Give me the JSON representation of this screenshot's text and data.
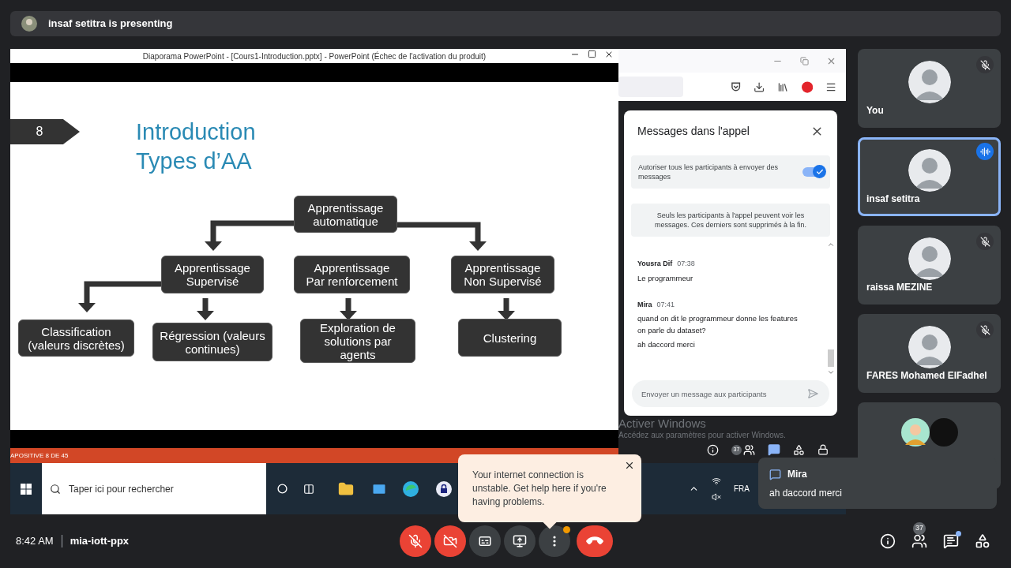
{
  "presenter_banner": {
    "text": "insaf setitra is presenting"
  },
  "shared_screen": {
    "powerpoint": {
      "title": "Diaporama PowerPoint - [Cours1-Introduction.pptx] - PowerPoint (Échec de l'activation du produit)",
      "slide_number": "8",
      "slide_title": [
        "Introduction",
        "Types d’AA"
      ],
      "nodes": [
        {
          "label": "Apprentissage\nautomatique"
        },
        {
          "label": "Apprentissage\nSupervisé"
        },
        {
          "label": "Apprentissage\nPar renforcement"
        },
        {
          "label": "Apprentissage\nNon Supervisé"
        },
        {
          "label": "Classification\n(valeurs discrètes)"
        },
        {
          "label": "Régression (valeurs\ncontinues)"
        },
        {
          "label": "Exploration de\nsolutions par\nagents"
        },
        {
          "label": "Clustering"
        }
      ],
      "status": "APOSITIVE 8 DE 45"
    },
    "chat": {
      "title": "Messages dans l'appel",
      "setting": {
        "label": "Autoriser tous les participants à envoyer des messages",
        "on": true
      },
      "notice": "Seuls les participants à l'appel peuvent voir les messages. Ces derniers sont supprimés à la fin.",
      "messages": [
        {
          "sender": "Yousra Dif",
          "time": "07:38",
          "lines": [
            "Le programmeur"
          ]
        },
        {
          "sender": "Mira",
          "time": "07:41",
          "lines": [
            "quand on dit le programmeur donne les features on parle du dataset?",
            "ah daccord merci"
          ]
        }
      ],
      "input": {
        "placeholder": "Envoyer un message aux participants"
      }
    },
    "windows_watermark": [
      "Activer Windows",
      "Accédez aux paramètres pour activer Windows."
    ],
    "mini_toolbar": {
      "people_count": "37"
    },
    "taskbar": {
      "search_placeholder": "Taper ici pour rechercher",
      "language": "FRA"
    }
  },
  "participants": [
    {
      "kind": "person",
      "name": "You",
      "muted": true,
      "speaking": false
    },
    {
      "kind": "person",
      "name": "insaf setitra",
      "muted": false,
      "speaking": true
    },
    {
      "kind": "person",
      "name": "raissa MEZINE",
      "muted": true,
      "speaking": false
    },
    {
      "kind": "person",
      "name": "FARES Mohamed ElFadhel",
      "muted": true,
      "speaking": false
    },
    {
      "kind": "group"
    }
  ],
  "connection_toast": {
    "text": "Your internet connection is unstable. Get help here if you're having problems."
  },
  "notification": {
    "sender": "Mira",
    "text": "ah daccord merci"
  },
  "bottom_bar": {
    "time": "8:42 AM",
    "meeting_code": "mia-iott-ppx",
    "controls": [
      {
        "kind": "mic",
        "off": true
      },
      {
        "kind": "camera",
        "off": true
      },
      {
        "kind": "captions",
        "off": false
      },
      {
        "kind": "present",
        "off": false
      },
      {
        "kind": "more",
        "alert": true
      },
      {
        "kind": "hangup"
      }
    ],
    "people_count": "37",
    "chat_unread": true
  }
}
